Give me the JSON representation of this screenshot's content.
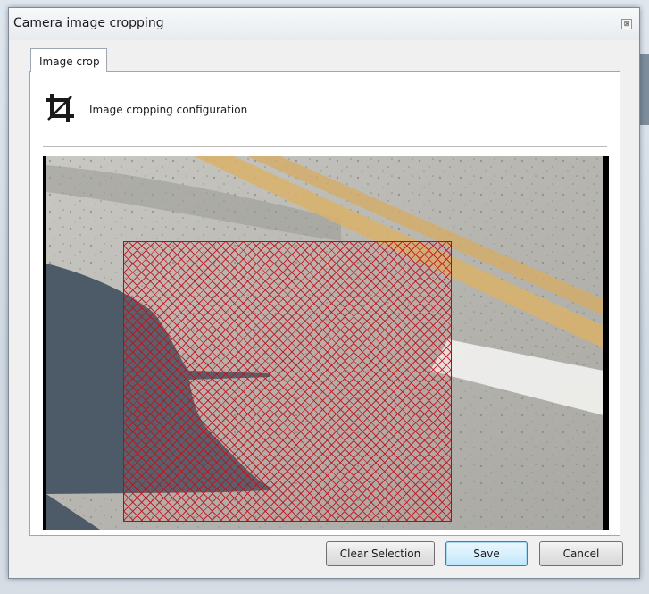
{
  "window": {
    "title": "Camera image cropping",
    "close_glyph": "⊠"
  },
  "tabs": [
    {
      "label": "Image crop",
      "active": true
    }
  ],
  "panel": {
    "heading": "Image cropping configuration",
    "icon": "crop-icon"
  },
  "preview": {
    "description_colors": {
      "road": "#bdbcb6",
      "shadow": "#4d5a68",
      "yellow_line": "#d9b26a",
      "white_line": "#f2f2f0",
      "selection": "#b9121c"
    }
  },
  "buttons": {
    "clear_selection": "Clear Selection",
    "save": "Save",
    "cancel": "Cancel"
  }
}
